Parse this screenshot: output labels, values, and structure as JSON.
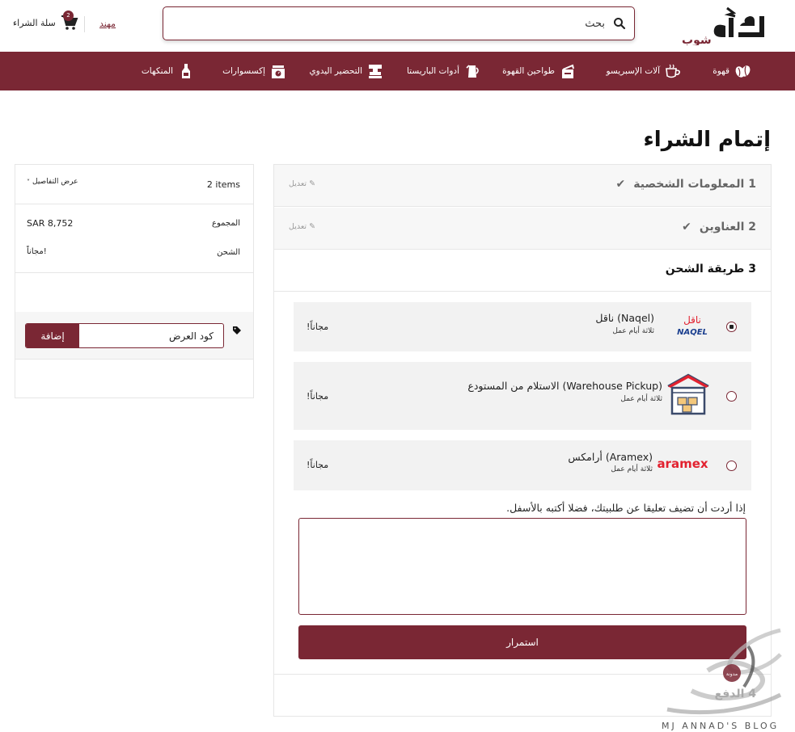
{
  "header": {
    "logo_text": "كافي شوب",
    "search_placeholder": "بحث",
    "user_link": "مهند",
    "cart_label": "سلة الشراء",
    "cart_count": "2"
  },
  "nav": {
    "items": [
      {
        "label": "قهوة",
        "icon": "coffee-beans-icon"
      },
      {
        "label": "آلات الإسبريسو",
        "icon": "coffee-cup-icon"
      },
      {
        "label": "طواحين القهوة",
        "icon": "grinder-icon"
      },
      {
        "label": "أدوات الباريستا",
        "icon": "milk-jug-icon"
      },
      {
        "label": "التحضير اليدوي",
        "icon": "pour-over-icon"
      },
      {
        "label": "إكسسوارات",
        "icon": "scale-icon"
      },
      {
        "label": "المنكهات",
        "icon": "syrup-bottle-icon"
      }
    ],
    "background": "#7a2734"
  },
  "page_title": "إتمام الشراء",
  "checkout": {
    "steps": [
      {
        "number": "1",
        "title": "المعلومات الشخصية",
        "edit": "تعديل",
        "done": true
      },
      {
        "number": "2",
        "title": "العناوين",
        "edit": "تعديل",
        "done": true
      },
      {
        "number": "3",
        "title": "طريقة الشحن",
        "active": true
      },
      {
        "number": "4",
        "title": "الدفع"
      }
    ],
    "shipping_options": [
      {
        "name": "(Naqel) ناقل",
        "delay": "ثلاثة أيام عمل",
        "price": "مجاناً!",
        "logo": "naqel-logo",
        "selected": true
      },
      {
        "name": "(Warehouse Pickup) الاستلام من المستودع",
        "delay": "ثلاثة أيام عمل",
        "price": "مجاناً!",
        "logo": "warehouse-icon",
        "selected": false
      },
      {
        "name": "(Aramex) أرامكس",
        "delay": "ثلاثة أيام عمل",
        "price": "مجاناً!",
        "logo": "aramex-logo",
        "selected": false
      }
    ],
    "naqel_logo_text": "NAQEL",
    "naqel_logo_arabic": "ناقل",
    "aramex_logo_text": "aramex",
    "comment_label": "إذا أردت أن تضيف تعليقا عن طلبيتك، فضلا أكتبه بالأسفل.",
    "continue_label": "استمرار"
  },
  "summary": {
    "items_count": "2 items",
    "details_label": "عرض التفاصيل",
    "total_label": "المجموع",
    "total_value": "SAR 8,752",
    "shipping_label": "الشحن",
    "shipping_value": "مجاناً!",
    "promo_placeholder": "كود العرض",
    "promo_button": "إضافة"
  },
  "watermark": {
    "text": "MJ ANNAD'S BLOG",
    "badge": "مدونة"
  },
  "colors": {
    "brand": "#7a2734",
    "aramex_red": "#e2212f",
    "naqel_blue": "#1b3f8f"
  }
}
